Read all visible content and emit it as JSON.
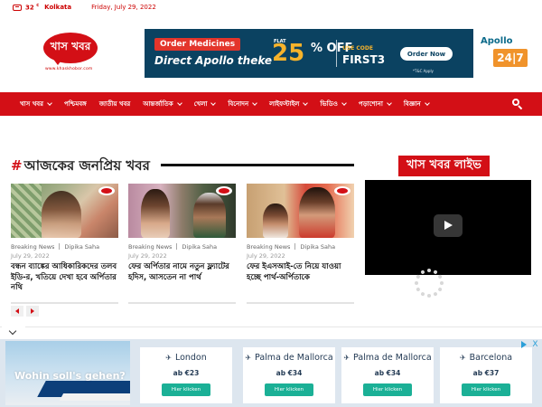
{
  "topbar": {
    "weather_icon": "cloud-icon",
    "temperature": "32",
    "temp_unit": "c",
    "city": "Kolkata",
    "date": "Friday, July 29, 2022"
  },
  "logo": {
    "text": "খাস খবর",
    "url": "www.khaskhobor.com"
  },
  "banner_ad": {
    "order_label": "Order Medicines",
    "tagline": "Direct Apollo theke",
    "flat_label": "FLAT",
    "discount": "25",
    "percent_off": "% OFF",
    "use_code_label": "USE CODE",
    "code": "FIRST3",
    "cta": "Order Now",
    "terms": "*T&C Apply",
    "brand": "Apollo",
    "brand_badge": "24|7"
  },
  "nav": {
    "items": [
      {
        "label": "খাস খবর",
        "dropdown": true
      },
      {
        "label": "পশ্চিমবঙ্গ",
        "dropdown": false
      },
      {
        "label": "জাতীয় খবর",
        "dropdown": false
      },
      {
        "label": "আন্তর্জাতিক",
        "dropdown": true
      },
      {
        "label": "খেলা",
        "dropdown": true
      },
      {
        "label": "বিনোদন",
        "dropdown": true
      },
      {
        "label": "লাইফস্টাইল",
        "dropdown": true
      },
      {
        "label": "ভিডিও",
        "dropdown": true
      },
      {
        "label": "পড়াশোনা",
        "dropdown": true
      },
      {
        "label": "বিজ্ঞান",
        "dropdown": true
      }
    ],
    "search_icon": "search-icon"
  },
  "section": {
    "title": "আজকের জনপ্রিয় খবর",
    "hash": "#"
  },
  "live": {
    "title": "খাস খবর লাইভ"
  },
  "articles": [
    {
      "category": "Breaking News",
      "author": "Dipika Saha",
      "date": "July 29, 2022",
      "headline": "বন্ধন ব্যাঙ্কের আধিকারিকদের তলব ইডি-র, খতিয়ে দেখা হবে অর্পিতার নথি"
    },
    {
      "category": "Breaking News",
      "author": "Dipika Saha",
      "date": "July 29, 2022",
      "headline": "ফের অর্পিতার নামে নতুন ফ্ল্যাটের হদিস, আসতেন না পার্থ"
    },
    {
      "category": "Breaking News",
      "author": "Dipika Saha",
      "date": "July 29, 2022",
      "headline": "ফের ইএসআই-তে নিয়ে যাওয়া হচ্ছে পার্থ-অর্পিতাকে"
    }
  ],
  "bottom_ad": {
    "question": "Wohin soll's gehen?",
    "destinations": [
      {
        "name": "London",
        "price": "ab €23",
        "cta": "Hier klicken"
      },
      {
        "name": "Palma de Mallorca",
        "price": "ab €34",
        "cta": "Hier klicken"
      },
      {
        "name": "Palma de Mallorca",
        "price": "ab €34",
        "cta": "Hier klicken"
      },
      {
        "name": "Barcelona",
        "price": "ab €37",
        "cta": "Hier klicken"
      }
    ],
    "close_label": "X"
  }
}
